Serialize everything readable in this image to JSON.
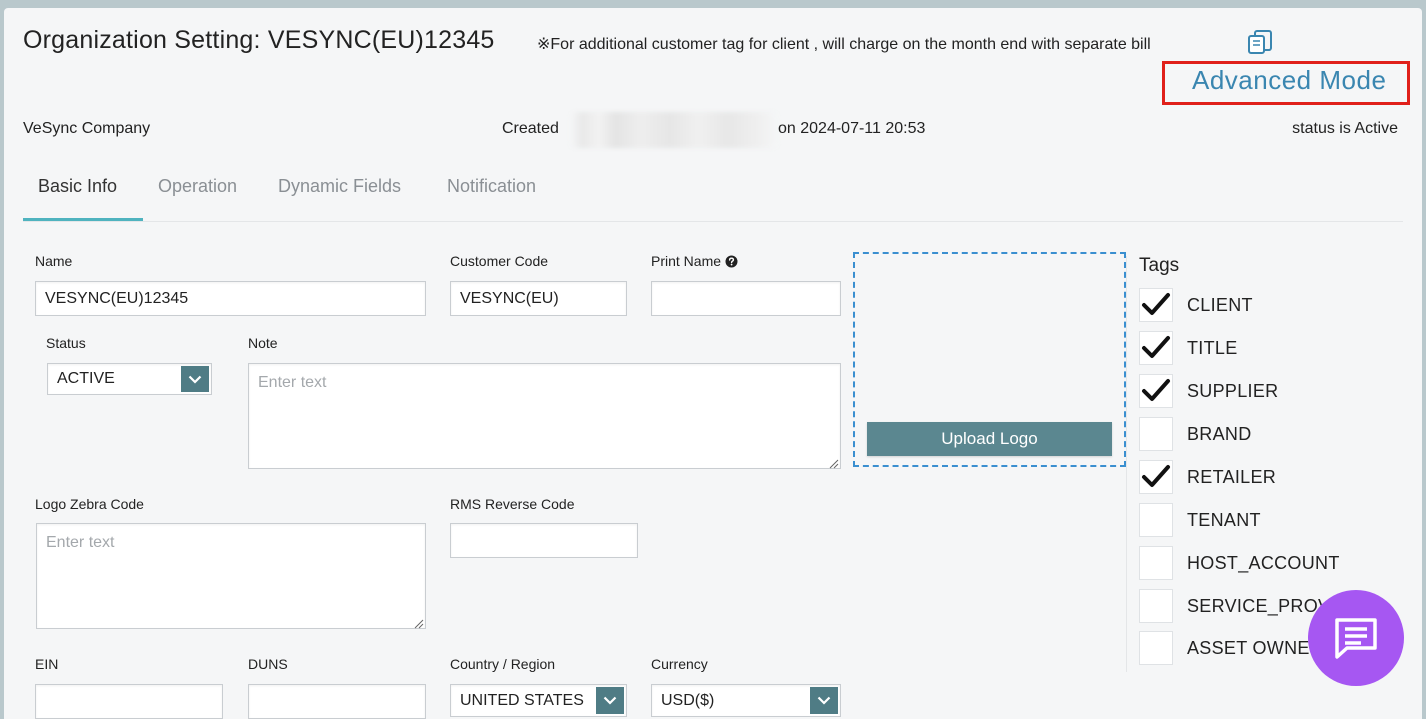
{
  "header": {
    "title": "Organization Setting: VESYNC(EU)12345",
    "note": "※For additional customer tag for client , will charge on the month end with separate bill",
    "advanced_mode": "Advanced Mode"
  },
  "meta": {
    "company": "VeSync Company",
    "created_prefix": "Created",
    "created_suffix": "on 2024-07-11 20:53",
    "status": "status is Active"
  },
  "tabs": [
    {
      "label": "Basic Info",
      "active": true
    },
    {
      "label": "Operation",
      "active": false
    },
    {
      "label": "Dynamic Fields",
      "active": false
    },
    {
      "label": "Notification",
      "active": false
    }
  ],
  "form": {
    "name": {
      "label": "Name",
      "value": "VESYNC(EU)12345"
    },
    "customer_code": {
      "label": "Customer Code",
      "value": "VESYNC(EU)"
    },
    "print_name": {
      "label": "Print Name",
      "value": ""
    },
    "status": {
      "label": "Status",
      "value": "ACTIVE"
    },
    "note": {
      "label": "Note",
      "placeholder": "Enter text"
    },
    "logo_zebra_code": {
      "label": "Logo Zebra Code",
      "placeholder": "Enter text"
    },
    "rms_reverse_code": {
      "label": "RMS Reverse Code",
      "value": ""
    },
    "ein": {
      "label": "EIN",
      "value": ""
    },
    "duns": {
      "label": "DUNS",
      "value": ""
    },
    "country_region": {
      "label": "Country / Region",
      "value": "UNITED STATES"
    },
    "currency": {
      "label": "Currency",
      "value": "USD($)"
    }
  },
  "upload": {
    "button_label": "Upload Logo"
  },
  "tags": {
    "title": "Tags",
    "items": [
      {
        "label": "CLIENT",
        "checked": true
      },
      {
        "label": "TITLE",
        "checked": true
      },
      {
        "label": "SUPPLIER",
        "checked": true
      },
      {
        "label": "BRAND",
        "checked": false
      },
      {
        "label": "RETAILER",
        "checked": true
      },
      {
        "label": "TENANT",
        "checked": false
      },
      {
        "label": "HOST_ACCOUNT",
        "checked": false
      },
      {
        "label": "SERVICE_PROV",
        "checked": false
      },
      {
        "label": "ASSET OWNE",
        "checked": false
      }
    ]
  },
  "colors": {
    "accent": "#4fb3bf",
    "select_button": "#5b8790",
    "advanced_link": "#3a86b0",
    "highlight_box": "#e0201a",
    "chat_fab": "#a657f2"
  },
  "icons": {
    "copy": "copy-icon",
    "help": "question-circle-icon",
    "dropdown": "chevron-down-icon",
    "check": "checkmark-icon",
    "chat": "chat-message-icon"
  }
}
